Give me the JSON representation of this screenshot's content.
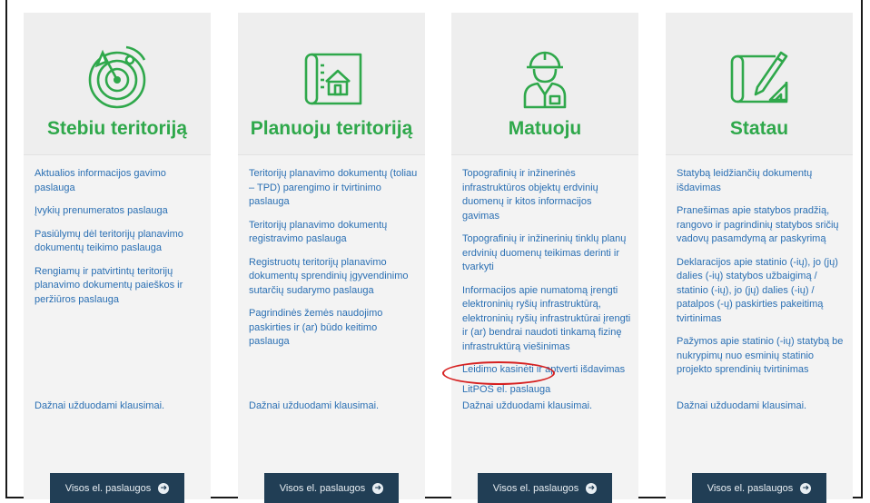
{
  "colors": {
    "accent": "#2fa84b",
    "link": "#2a6fb3",
    "button": "#213e55",
    "highlight": "#d62020"
  },
  "button_label": "Visos el. paslaugos",
  "faq_label": "Dažnai užduodami klausimai.",
  "cards": [
    {
      "icon": "radar-target-icon",
      "title": "Stebiu teritoriją",
      "links": [
        "Aktualios informacijos gavimo paslauga",
        "Įvykių prenumeratos paslauga",
        "Pasiūlymų dėl teritorijų planavimo dokumentų teikimo paslauga",
        "Rengiamų ir patvirtintų teritorijų planavimo dokumentų paieškos ir peržiūros paslauga"
      ]
    },
    {
      "icon": "house-blueprint-icon",
      "title": "Planuoju teritoriją",
      "links": [
        "Teritorijų planavimo dokumentų (toliau – TPD) parengimo ir tvirtinimo paslauga",
        "Teritorijų planavimo dokumentų registravimo paslauga",
        "Registruotų teritorijų planavimo dokumentų sprendinių įgyvendinimo sutarčių sudarymo paslauga",
        "Pagrindinės žemės naudojimo paskirties ir (ar) būdo keitimo paslauga"
      ]
    },
    {
      "icon": "engineer-worker-icon",
      "title": "Matuoju",
      "links": [
        "Topografinių ir inžinerinės infrastruktūros objektų erdvinių duomenų ir kitos informacijos gavimas",
        "Topografinių ir inžinerinių tinklų planų erdvinių duomenų teikimas derinti ir tvarkyti",
        "Informacijos apie numatomą įrengti elektroninių ryšių infrastruktūrą, elektroninių ryšių infrastruktūrai įrengti ir (ar) bendrai naudoti tinkamą fizinę infrastruktūrą viešinimas",
        "Leidimo kasinėti ir aptverti išdavimas",
        "LitPOS el. paslauga"
      ]
    },
    {
      "icon": "blueprint-pencil-icon",
      "title": "Statau",
      "links": [
        "Statybą leidžiančių dokumentų išdavimas",
        "Pranešimas apie statybos pradžią, rangovo ir pagrindinių statybos sričių vadovų pasamdymą ar paskyrimą",
        "Deklaracijos apie statinio (-ių), jo (jų) dalies (-ių) statybos užbaigimą / statinio (-ių), jo (jų) dalies (-ių) / patalpos (-ų) paskirties pakeitimą tvirtinimas",
        "Pažymos apie statinio (-ių) statybą be nukrypimų nuo esminių statinio projekto sprendinių tvirtinimas"
      ]
    }
  ]
}
